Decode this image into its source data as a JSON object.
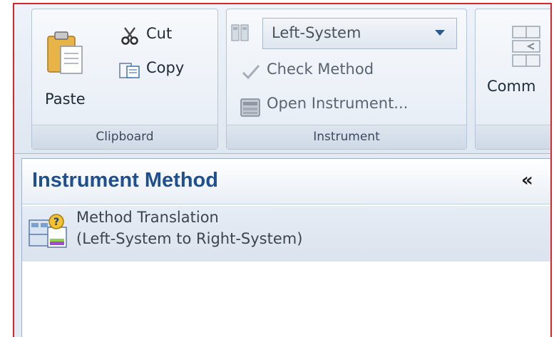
{
  "ribbon": {
    "clipboard": {
      "group_label": "Clipboard",
      "paste_label": "Paste",
      "cut_label": "Cut",
      "copy_label": "Copy"
    },
    "instrument": {
      "group_label": "Instrument",
      "system_select": {
        "selected": "Left-System"
      },
      "check_method_label": "Check Method",
      "open_instrument_label": "Open Instrument..."
    },
    "commands": {
      "label_partial": "Comm"
    }
  },
  "pane": {
    "title": "Instrument Method",
    "collapse_glyph": "«",
    "items": [
      {
        "line1": "Method Translation",
        "line2": "(Left-System to Right-System)"
      }
    ]
  },
  "colors": {
    "frame_border": "#d9262a",
    "title_blue": "#1d4f91",
    "ribbon_bg": "#e3eaf3",
    "selected_item_bg": "#dfe6ef"
  }
}
